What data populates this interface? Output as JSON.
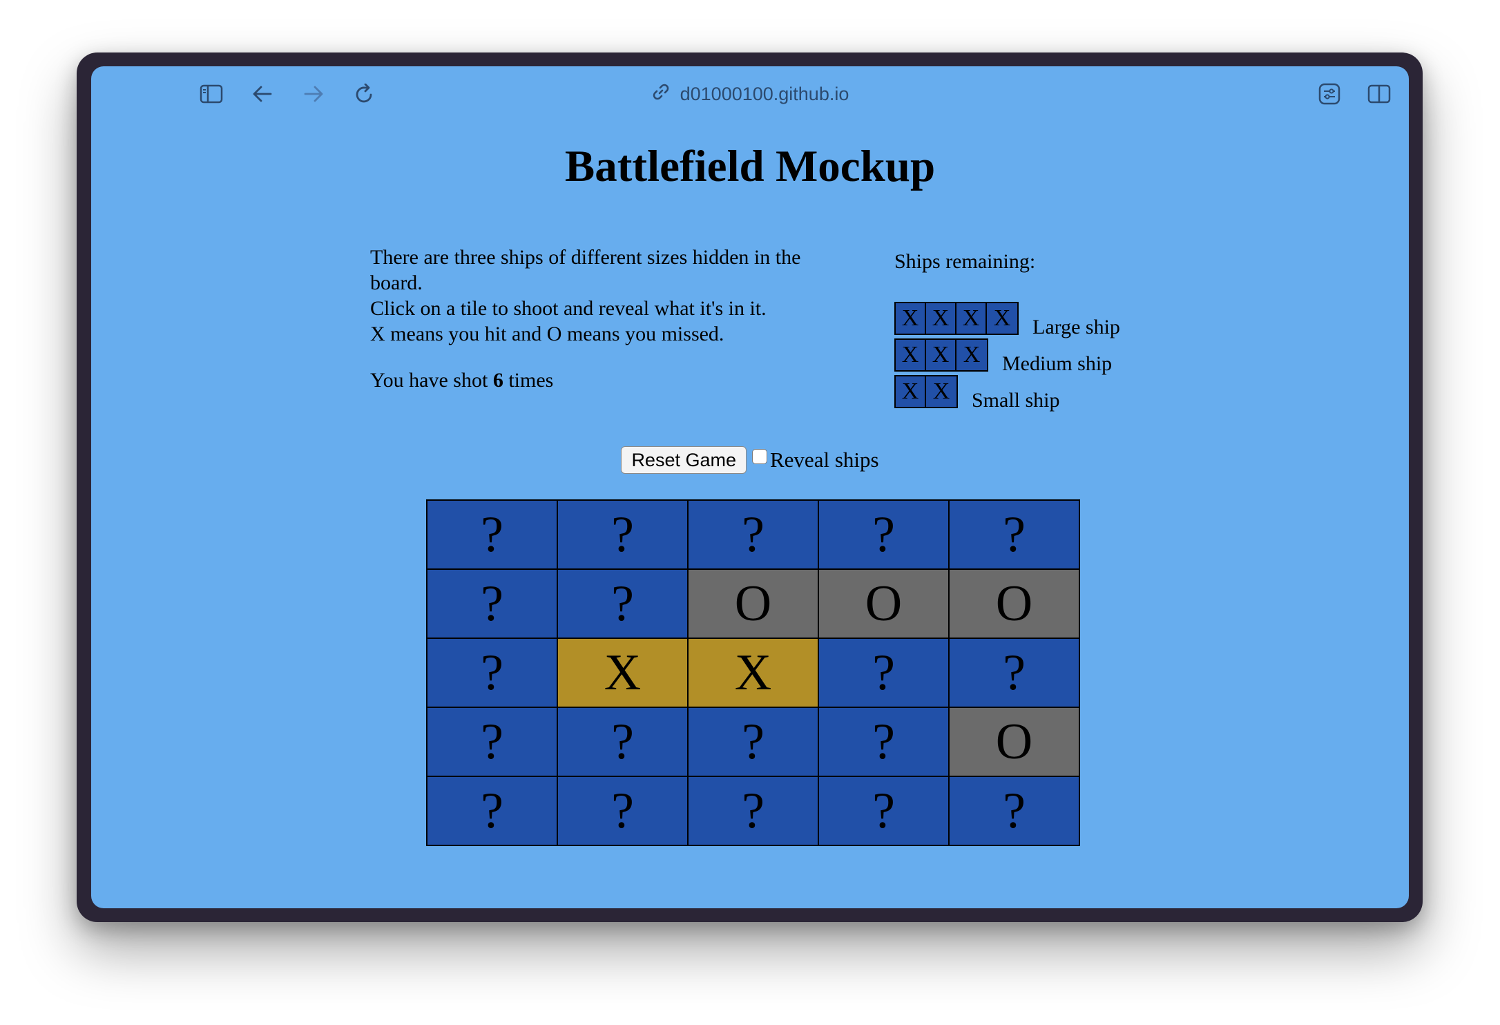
{
  "browser": {
    "url": "d01000100.github.io",
    "icons": [
      "sidebar-icon",
      "back-arrow-icon",
      "forward-arrow-icon",
      "reload-icon",
      "link-icon",
      "extensions-icon",
      "split-view-icon"
    ]
  },
  "page": {
    "title": "Battlefield Mockup",
    "intro_line1": "There are three ships of different sizes hidden in the board.",
    "intro_line2": "Click on a tile to shoot and reveal what it's in it.",
    "intro_line3": "X means you hit and O means you missed.",
    "shots_prefix": "You have shot",
    "shots_count": "6",
    "shots_suffix": "times",
    "ships_heading": "Ships remaining:",
    "ships": [
      {
        "label": "Large ship",
        "cells": [
          "X",
          "X",
          "X",
          "X"
        ]
      },
      {
        "label": "Medium ship",
        "cells": [
          "X",
          "X",
          "X"
        ]
      },
      {
        "label": "Small ship",
        "cells": [
          "X",
          "X"
        ]
      }
    ],
    "reset_label": "Reset Game",
    "reveal_label": "Reveal ships",
    "reveal_checked": false
  },
  "board": [
    [
      "?",
      "?",
      "?",
      "?",
      "?"
    ],
    [
      "?",
      "?",
      "O",
      "O",
      "O"
    ],
    [
      "?",
      "X",
      "X",
      "?",
      "?"
    ],
    [
      "?",
      "?",
      "?",
      "?",
      "O"
    ],
    [
      "?",
      "?",
      "?",
      "?",
      "?"
    ]
  ],
  "colors": {
    "background": "#67adee",
    "tile_hidden": "#2150a8",
    "tile_hit": "#b28f27",
    "tile_miss": "#6b6b6b"
  }
}
